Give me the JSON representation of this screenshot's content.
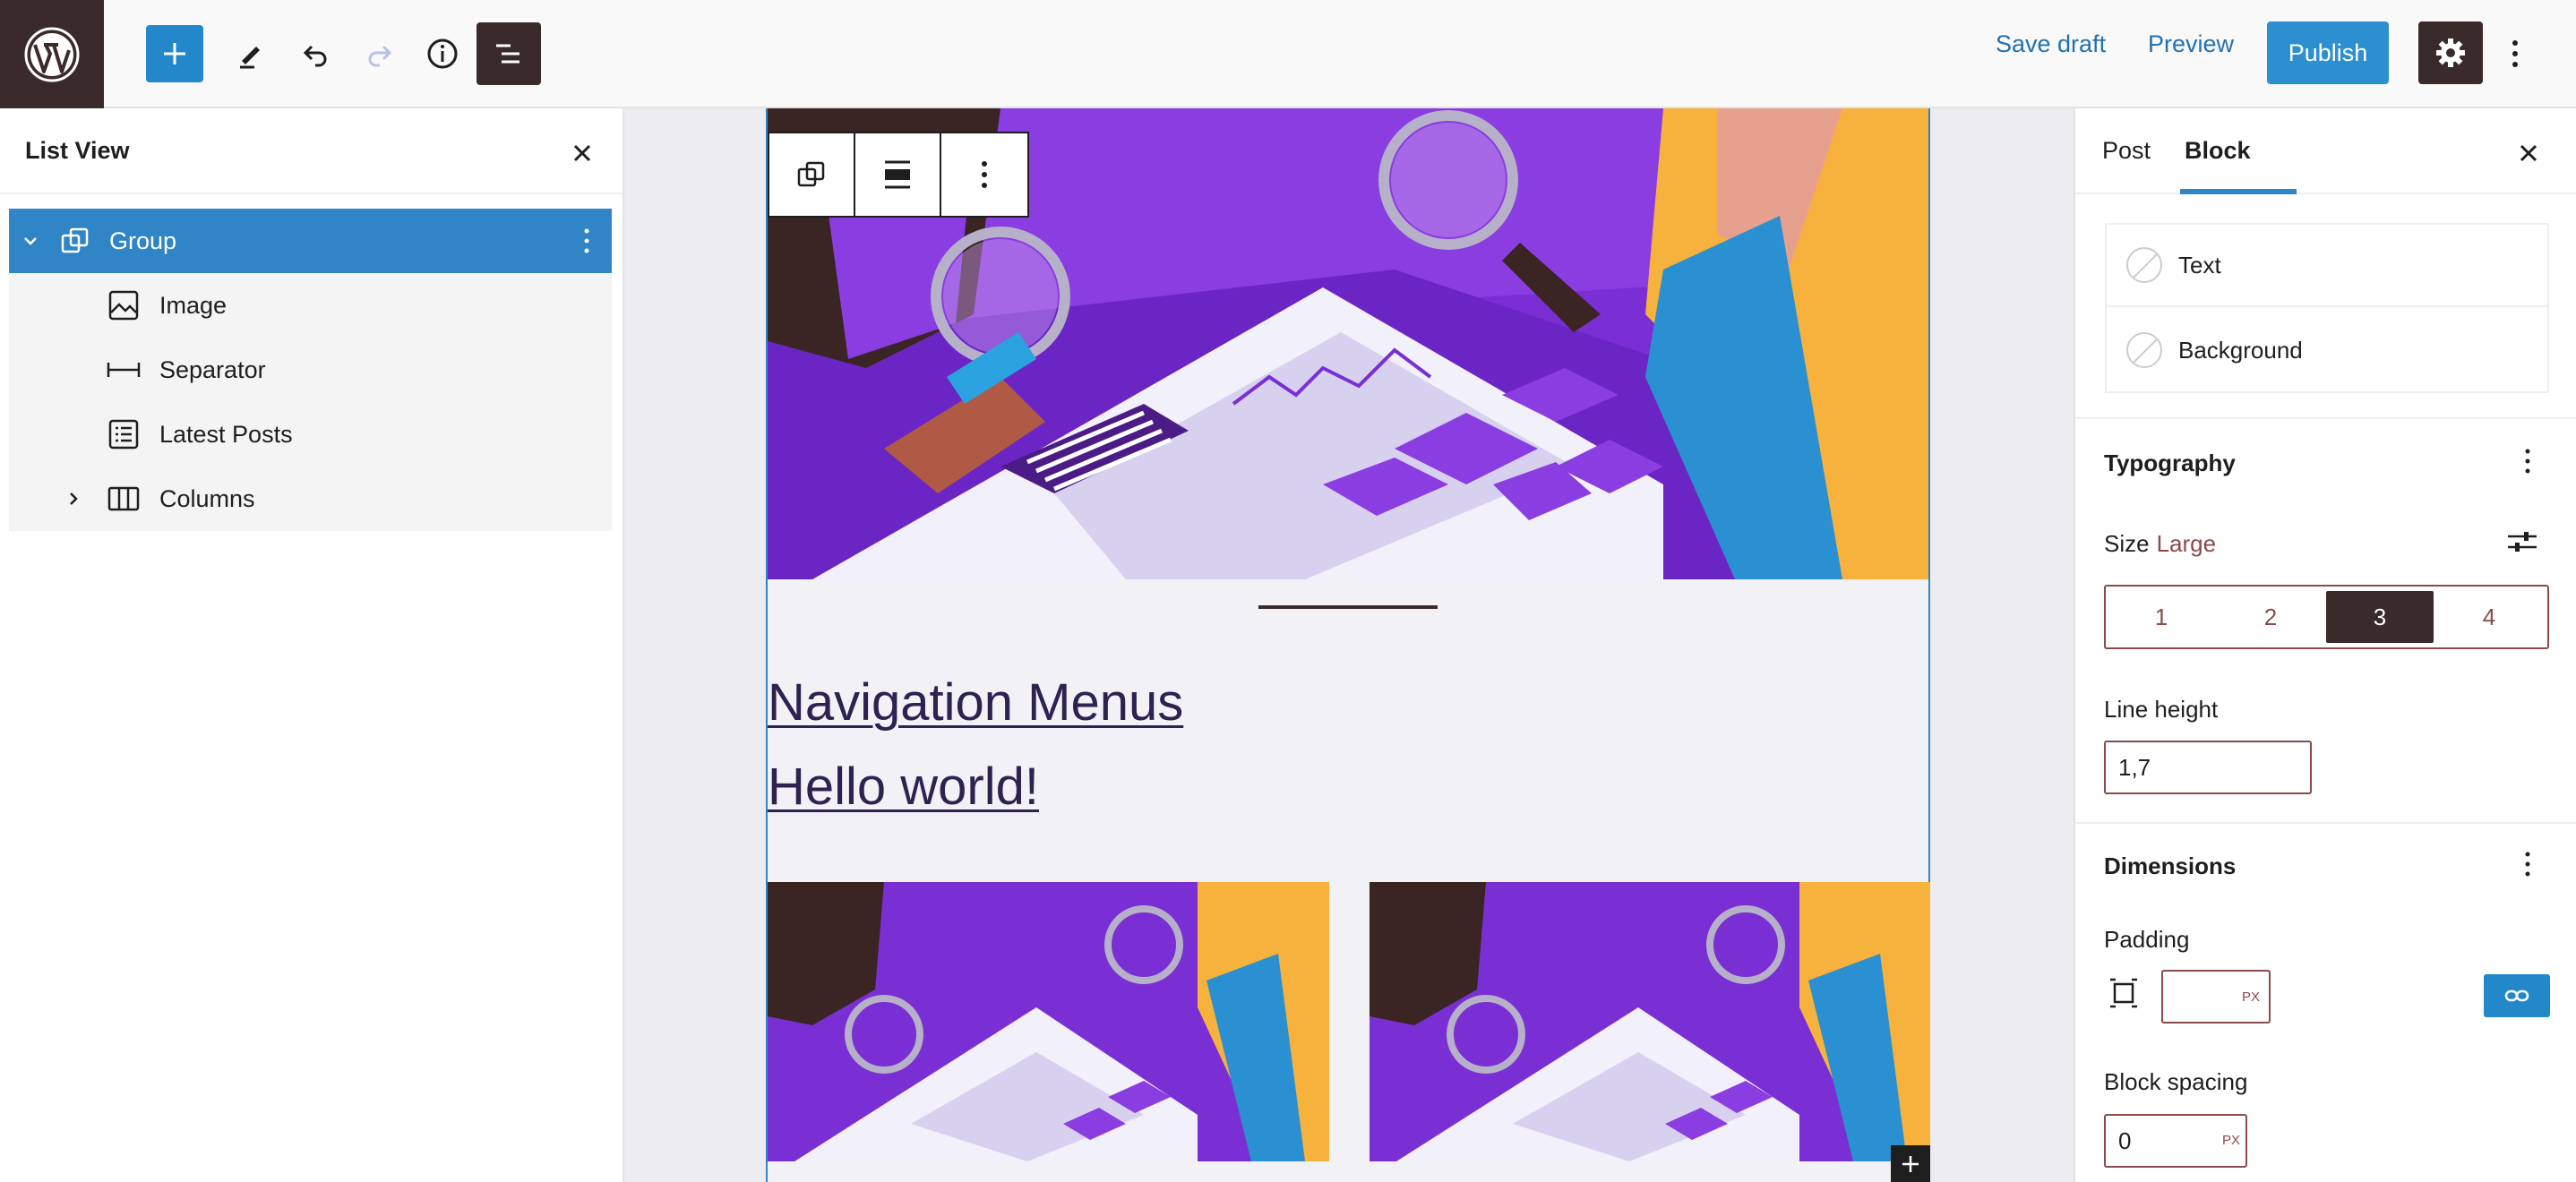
{
  "topbar": {
    "save_draft": "Save draft",
    "preview": "Preview",
    "publish": "Publish",
    "icons": [
      "wordpress-logo",
      "plus-icon",
      "pencil-icon",
      "undo-icon",
      "redo-icon",
      "info-icon",
      "list-view-icon",
      "gear-icon",
      "more-vertical-icon"
    ]
  },
  "list_view": {
    "title": "List View",
    "items": [
      {
        "label": "Group",
        "icon": "group-icon",
        "selected": true,
        "expandable": true,
        "expanded": true
      },
      {
        "label": "Image",
        "icon": "image-icon"
      },
      {
        "label": "Separator",
        "icon": "separator-icon"
      },
      {
        "label": "Latest Posts",
        "icon": "latest-posts-icon"
      },
      {
        "label": "Columns",
        "icon": "columns-icon",
        "expandable": true,
        "expanded": false
      }
    ]
  },
  "canvas": {
    "links": [
      "Navigation Menus",
      "Hello world!"
    ]
  },
  "sidebar": {
    "tabs": [
      "Post",
      "Block"
    ],
    "active_tab": "Block",
    "color": {
      "text": "Text",
      "background": "Background"
    },
    "typography": {
      "title": "Typography",
      "size_label": "Size",
      "size_value": "Large",
      "size_options": [
        "1",
        "2",
        "3",
        "4"
      ],
      "size_selected": "3",
      "line_height_label": "Line height",
      "line_height_value": "1,7"
    },
    "dimensions": {
      "title": "Dimensions",
      "padding_label": "Padding",
      "padding_value": "",
      "padding_unit": "PX",
      "block_spacing_label": "Block spacing",
      "block_spacing_value": "0",
      "block_spacing_unit": "PX"
    }
  },
  "colors": {
    "accent": "#2f85c5",
    "dark": "#3b2a2a",
    "illustration_purple": "#7b2fd0"
  }
}
